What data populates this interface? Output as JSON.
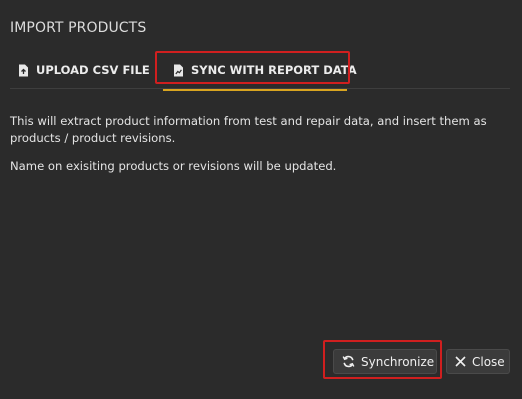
{
  "dialog": {
    "title": "IMPORT PRODUCTS"
  },
  "tabs": [
    {
      "label": "UPLOAD CSV FILE",
      "icon": "file-upload-icon",
      "active": false
    },
    {
      "label": "SYNC WITH REPORT DATA",
      "icon": "report-chart-icon",
      "active": true
    }
  ],
  "content": {
    "paragraph1": "This will extract product information from test and repair data, and insert them as products / product revisions.",
    "paragraph2": "Name on exisiting products or revisions will be updated."
  },
  "buttons": {
    "synchronize": {
      "label": "Synchronize",
      "icon": "sync-icon"
    },
    "close": {
      "label": "Close",
      "icon": "close-icon"
    }
  },
  "colors": {
    "background": "#2b2b2b",
    "active_tab_underline": "#d9a520",
    "highlight_box": "#d01f1f",
    "button_bg": "#3b3b3b"
  }
}
